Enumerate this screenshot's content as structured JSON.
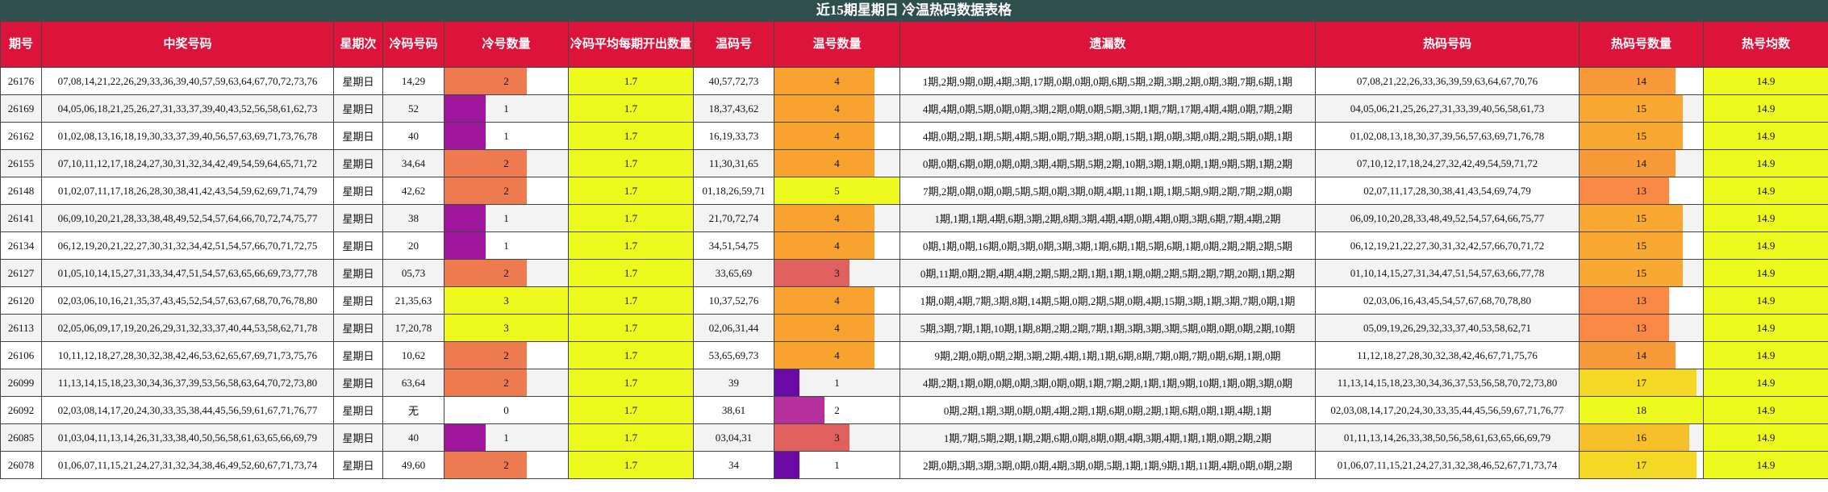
{
  "title": "近15期星期日 冷温热码数据表格",
  "headers": [
    "期号",
    "中奖号码",
    "星期次",
    "冷码号码",
    "冷号数量",
    "冷码平均每期开出数量",
    "温码号",
    "温号数量",
    "遗漏数",
    "热码号码",
    "热码号数量",
    "热号均数"
  ],
  "colors": {
    "title_bg": "#2f4f4f",
    "header_bg": "#dc143c",
    "avg_bg": "#eefa1e",
    "hot_bg": "#eefa1e"
  },
  "rows": [
    {
      "issue": "26176",
      "numbers": "07,08,14,21,22,26,29,33,36,39,40,57,59,63,64,67,70,72,73,76",
      "weekday": "星期日",
      "cold": "14,29",
      "cold_count": 2,
      "cold_avg": "1.7",
      "warm": "40,57,72,73",
      "warm_count": 4,
      "miss": "1期,2期,9期,0期,4期,3期,17期,0期,0期,0期,6期,5期,2期,3期,2期,0期,3期,7期,6期,1期",
      "hot": "07,08,21,22,26,33,36,39,59,63,64,67,70,76",
      "hot_count": 14,
      "hot_avg": "14.9"
    },
    {
      "issue": "26169",
      "numbers": "04,05,06,18,21,25,26,27,31,33,37,39,40,43,52,56,58,61,62,73",
      "weekday": "星期日",
      "cold": "52",
      "cold_count": 1,
      "cold_avg": "1.7",
      "warm": "18,37,43,62",
      "warm_count": 4,
      "miss": "4期,4期,0期,5期,0期,0期,3期,2期,0期,0期,5期,3期,1期,7期,17期,4期,4期,0期,7期,2期",
      "hot": "04,05,06,21,25,26,27,31,33,39,40,56,58,61,73",
      "hot_count": 15,
      "hot_avg": "14.9"
    },
    {
      "issue": "26162",
      "numbers": "01,02,08,13,16,18,19,30,33,37,39,40,56,57,63,69,71,73,76,78",
      "weekday": "星期日",
      "cold": "40",
      "cold_count": 1,
      "cold_avg": "1.7",
      "warm": "16,19,33,73",
      "warm_count": 4,
      "miss": "4期,0期,2期,1期,5期,4期,5期,0期,7期,3期,0期,15期,1期,0期,3期,0期,2期,5期,0期,1期",
      "hot": "01,02,08,13,18,30,37,39,56,57,63,69,71,76,78",
      "hot_count": 15,
      "hot_avg": "14.9"
    },
    {
      "issue": "26155",
      "numbers": "07,10,11,12,17,18,24,27,30,31,32,34,42,49,54,59,64,65,71,72",
      "weekday": "星期日",
      "cold": "34,64",
      "cold_count": 2,
      "cold_avg": "1.7",
      "warm": "11,30,31,65",
      "warm_count": 4,
      "miss": "0期,0期,6期,0期,0期,0期,3期,4期,5期,5期,2期,10期,3期,1期,0期,1期,9期,5期,1期,2期",
      "hot": "07,10,12,17,18,24,27,32,42,49,54,59,71,72",
      "hot_count": 14,
      "hot_avg": "14.9"
    },
    {
      "issue": "26148",
      "numbers": "01,02,07,11,17,18,26,28,30,38,41,42,43,54,59,62,69,71,74,79",
      "weekday": "星期日",
      "cold": "42,62",
      "cold_count": 2,
      "cold_avg": "1.7",
      "warm": "01,18,26,59,71",
      "warm_count": 5,
      "miss": "7期,2期,0期,0期,0期,5期,5期,0期,3期,0期,4期,11期,1期,1期,5期,9期,2期,7期,2期,0期",
      "hot": "02,07,11,17,28,30,38,41,43,54,69,74,79",
      "hot_count": 13,
      "hot_avg": "14.9"
    },
    {
      "issue": "26141",
      "numbers": "06,09,10,20,21,28,33,38,48,49,52,54,57,64,66,70,72,74,75,77",
      "weekday": "星期日",
      "cold": "38",
      "cold_count": 1,
      "cold_avg": "1.7",
      "warm": "21,70,72,74",
      "warm_count": 4,
      "miss": "1期,1期,1期,4期,6期,3期,2期,8期,3期,4期,4期,0期,4期,0期,3期,6期,7期,4期,2期",
      "hot": "06,09,10,20,28,33,48,49,52,54,57,64,66,75,77",
      "hot_count": 15,
      "hot_avg": "14.9"
    },
    {
      "issue": "26134",
      "numbers": "06,12,19,20,21,22,27,30,31,32,34,42,51,54,57,66,70,71,72,75",
      "weekday": "星期日",
      "cold": "20",
      "cold_count": 1,
      "cold_avg": "1.7",
      "warm": "34,51,54,75",
      "warm_count": 4,
      "miss": "0期,1期,0期,16期,0期,3期,0期,3期,3期,1期,6期,1期,5期,6期,1期,0期,2期,2期,2期,5期",
      "hot": "06,12,19,21,22,27,30,31,32,42,57,66,70,71,72",
      "hot_count": 15,
      "hot_avg": "14.9"
    },
    {
      "issue": "26127",
      "numbers": "01,05,10,14,15,27,31,33,34,47,51,54,57,63,65,66,69,73,77,78",
      "weekday": "星期日",
      "cold": "05,73",
      "cold_count": 2,
      "cold_avg": "1.7",
      "warm": "33,65,69",
      "warm_count": 3,
      "miss": "0期,11期,0期,2期,4期,4期,2期,5期,2期,1期,1期,1期,0期,2期,5期,2期,7期,20期,1期,2期",
      "hot": "01,10,14,15,27,31,34,47,51,54,57,63,66,77,78",
      "hot_count": 15,
      "hot_avg": "14.9"
    },
    {
      "issue": "26120",
      "numbers": "02,03,06,10,16,21,35,37,43,45,52,54,57,63,67,68,70,76,78,80",
      "weekday": "星期日",
      "cold": "21,35,63",
      "cold_count": 3,
      "cold_avg": "1.7",
      "warm": "10,37,52,76",
      "warm_count": 4,
      "miss": "1期,0期,4期,7期,3期,8期,14期,5期,0期,2期,5期,0期,4期,15期,3期,1期,3期,7期,0期,1期",
      "hot": "02,03,06,16,43,45,54,57,67,68,70,78,80",
      "hot_count": 13,
      "hot_avg": "14.9"
    },
    {
      "issue": "26113",
      "numbers": "02,05,06,09,17,19,20,26,29,31,32,33,37,40,44,53,58,62,71,78",
      "weekday": "星期日",
      "cold": "17,20,78",
      "cold_count": 3,
      "cold_avg": "1.7",
      "warm": "02,06,31,44",
      "warm_count": 4,
      "miss": "5期,3期,7期,1期,10期,1期,8期,2期,2期,7期,1期,3期,3期,3期,5期,0期,0期,0期,2期,10期",
      "hot": "05,09,19,26,29,32,33,37,40,53,58,62,71",
      "hot_count": 13,
      "hot_avg": "14.9"
    },
    {
      "issue": "26106",
      "numbers": "10,11,12,18,27,28,30,32,38,42,46,53,62,65,67,69,71,73,75,76",
      "weekday": "星期日",
      "cold": "10,62",
      "cold_count": 2,
      "cold_avg": "1.7",
      "warm": "53,65,69,73",
      "warm_count": 4,
      "miss": "9期,2期,0期,0期,2期,3期,2期,4期,1期,1期,6期,8期,7期,0期,7期,0期,6期,1期,0期",
      "hot": "11,12,18,27,28,30,32,38,42,46,67,71,75,76",
      "hot_count": 14,
      "hot_avg": "14.9"
    },
    {
      "issue": "26099",
      "numbers": "11,13,14,15,18,23,30,34,36,37,39,53,56,58,63,64,70,72,73,80",
      "weekday": "星期日",
      "cold": "63,64",
      "cold_count": 2,
      "cold_avg": "1.7",
      "warm": "39",
      "warm_count": 1,
      "miss": "4期,2期,1期,0期,0期,0期,3期,0期,0期,1期,7期,2期,1期,1期,9期,10期,1期,0期,3期,0期",
      "hot": "11,13,14,15,18,23,30,34,36,37,53,56,58,70,72,73,80",
      "hot_count": 17,
      "hot_avg": "14.9"
    },
    {
      "issue": "26092",
      "numbers": "02,03,08,14,17,20,24,30,33,35,38,44,45,56,59,61,67,71,76,77",
      "weekday": "星期日",
      "cold": "无",
      "cold_count": 0,
      "cold_avg": "1.7",
      "warm": "38,61",
      "warm_count": 2,
      "miss": "0期,2期,1期,3期,0期,0期,4期,2期,1期,6期,0期,2期,1期,6期,0期,1期,4期,1期",
      "hot": "02,03,08,14,17,20,24,30,33,35,44,45,56,59,67,71,76,77",
      "hot_count": 18,
      "hot_avg": "14.9"
    },
    {
      "issue": "26085",
      "numbers": "01,03,04,11,13,14,26,31,33,38,40,50,56,58,61,63,65,66,69,79",
      "weekday": "星期日",
      "cold": "40",
      "cold_count": 1,
      "cold_avg": "1.7",
      "warm": "03,04,31",
      "warm_count": 3,
      "miss": "1期,7期,5期,2期,1期,2期,6期,0期,8期,0期,4期,3期,4期,1期,1期,0期,2期,2期",
      "hot": "01,11,13,14,26,33,38,50,56,58,61,63,65,66,69,79",
      "hot_count": 16,
      "hot_avg": "14.9"
    },
    {
      "issue": "26078",
      "numbers": "01,06,07,11,15,21,24,27,31,32,34,38,46,49,52,60,67,71,73,74",
      "weekday": "星期日",
      "cold": "49,60",
      "cold_count": 2,
      "cold_avg": "1.7",
      "warm": "34",
      "warm_count": 1,
      "miss": "2期,0期,3期,3期,3期,0期,0期,4期,3期,0期,5期,1期,1期,9期,1期,11期,4期,0期,0期,2期",
      "hot": "01,06,07,11,15,21,24,27,31,32,38,46,52,67,71,73,74",
      "hot_count": 17,
      "hot_avg": "14.9"
    }
  ]
}
